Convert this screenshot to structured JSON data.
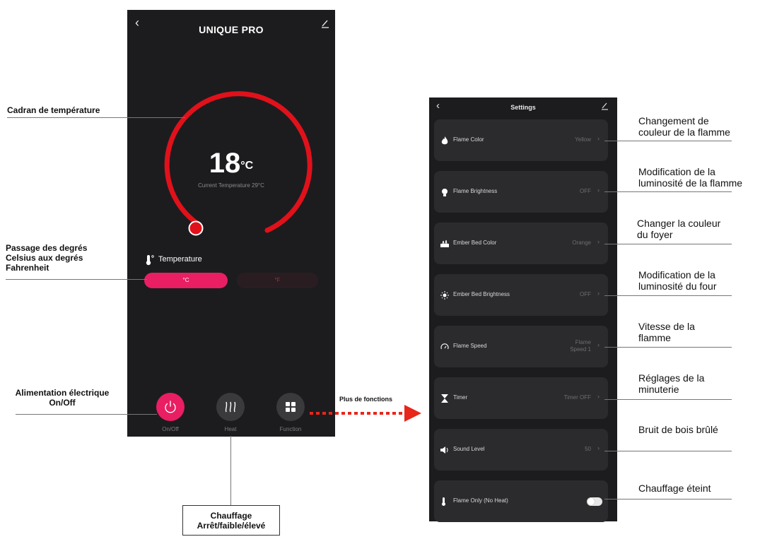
{
  "left_phone": {
    "title": "UNIQUE PRO",
    "temperature_value": "18",
    "temperature_unit": "°C",
    "current_temperature": "Current Temperature 29°C",
    "section_label": "Temperature",
    "unit_celsius": "°C",
    "unit_fahrenheit": "°F",
    "selected_unit": "°C",
    "buttons": [
      {
        "label": "On/Off",
        "icon": "power-icon"
      },
      {
        "label": "Heat",
        "icon": "heat-waves-icon"
      },
      {
        "label": "Function",
        "icon": "grid-icon"
      }
    ],
    "colors": {
      "accent": "#e91e63",
      "dial": "#e0111a",
      "background": "#1c1c1f"
    }
  },
  "right_phone": {
    "title": "Settings",
    "rows": [
      {
        "label": "Flame Color",
        "value": "Yellow",
        "icon": "flame-icon"
      },
      {
        "label": "Flame Brightness",
        "value": "OFF",
        "icon": "bulb-icon"
      },
      {
        "label": "Ember Bed Color",
        "value": "Orange",
        "icon": "ember-bed-icon"
      },
      {
        "label": "Ember Bed Brightness",
        "value": "OFF",
        "icon": "sun-icon"
      },
      {
        "label": "Flame Speed",
        "value_line1": "Flame",
        "value_line2": "Speed 1",
        "icon": "speedometer-icon"
      },
      {
        "label": "Timer",
        "value": "Timer OFF",
        "icon": "hourglass-icon"
      },
      {
        "label": "Sound Level",
        "value": "50",
        "icon": "speaker-icon"
      },
      {
        "label": "Flame Only (No Heat)",
        "toggle": "off",
        "icon": "thermometer-icon"
      }
    ]
  },
  "annotations_left": {
    "dial": "Cadran de température",
    "units_line1": "Passage des degrés",
    "units_line2": "Celsius aux degrés",
    "units_line3": "Fahrenheit",
    "power_line1": "Alimentation électrique",
    "power_line2": "On/Off",
    "more_functions": "Plus de fonctions",
    "heat_line1": "Chauffage",
    "heat_line2": "Arrêt/faible/élevé"
  },
  "annotations_right": [
    {
      "line1": "Changement de",
      "line2": "couleur de la flamme"
    },
    {
      "line1": "Modification de la",
      "line2": "luminosité de la flamme"
    },
    {
      "line1": "Changer la couleur",
      "line2": "du foyer"
    },
    {
      "line1": "Modification de la",
      "line2": "luminosité du four"
    },
    {
      "line1": "Vitesse de la",
      "line2": "flamme"
    },
    {
      "line1": "Réglages de la",
      "line2": "minuterie"
    },
    {
      "line1": "Bruit de bois brûlé",
      "line2": ""
    },
    {
      "line1": "Chauffage éteint",
      "line2": ""
    }
  ]
}
